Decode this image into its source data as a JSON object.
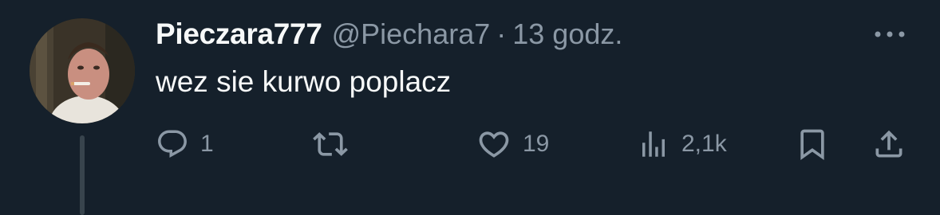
{
  "tweet": {
    "display_name": "Pieczara777",
    "handle": "@Piechara7",
    "separator": "·",
    "timestamp": "13 godz.",
    "text": "wez sie kurwo poplacz"
  },
  "actions": {
    "reply": {
      "icon": "reply-icon",
      "count": "1"
    },
    "retweet": {
      "icon": "retweet-icon",
      "count": ""
    },
    "like": {
      "icon": "heart-icon",
      "count": "19"
    },
    "views": {
      "icon": "views-icon",
      "count": "2,1k"
    },
    "bookmark": {
      "icon": "bookmark-icon"
    },
    "share": {
      "icon": "share-icon"
    }
  },
  "colors": {
    "background": "#15202b",
    "text_primary": "#f7f9f9",
    "text_secondary": "#8b98a5",
    "thread_line": "#38444d"
  }
}
